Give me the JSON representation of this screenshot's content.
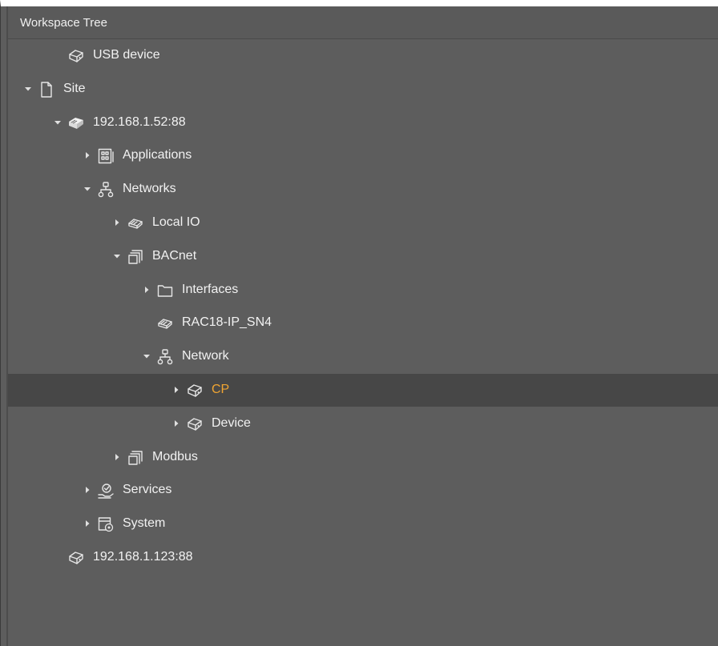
{
  "panel": {
    "title": "Workspace Tree"
  },
  "tree": [
    {
      "label": "USB device",
      "icon": "device-icon",
      "expand": "none",
      "selected": false
    },
    {
      "label": "Site",
      "icon": "page-icon",
      "expand": "expanded",
      "selected": false
    },
    {
      "label": "192.168.1.52:88",
      "icon": "connected-device-icon",
      "expand": "expanded",
      "selected": false
    },
    {
      "label": "Applications",
      "icon": "applications-icon",
      "expand": "collapsed",
      "selected": false
    },
    {
      "label": "Networks",
      "icon": "network-icon",
      "expand": "expanded",
      "selected": false
    },
    {
      "label": "Local IO",
      "icon": "io-module-icon",
      "expand": "collapsed",
      "selected": false
    },
    {
      "label": "BACnet",
      "icon": "protocol-icon",
      "expand": "expanded",
      "selected": false
    },
    {
      "label": "Interfaces",
      "icon": "folder-icon",
      "expand": "collapsed",
      "selected": false
    },
    {
      "label": "RAC18-IP_SN4",
      "icon": "io-module-icon",
      "expand": "none",
      "selected": false
    },
    {
      "label": "Network",
      "icon": "network-icon",
      "expand": "expanded",
      "selected": false
    },
    {
      "label": "CP",
      "icon": "device-icon",
      "expand": "collapsed",
      "selected": true
    },
    {
      "label": "Device",
      "icon": "device-icon",
      "expand": "collapsed",
      "selected": false
    },
    {
      "label": "Modbus",
      "icon": "protocol-icon",
      "expand": "collapsed",
      "selected": false
    },
    {
      "label": "Services",
      "icon": "services-icon",
      "expand": "collapsed",
      "selected": false
    },
    {
      "label": "System",
      "icon": "system-icon",
      "expand": "collapsed",
      "selected": false
    },
    {
      "label": "192.168.1.123:88",
      "icon": "device-icon",
      "expand": "none",
      "selected": false
    }
  ],
  "colors": {
    "background": "#5d5d5d",
    "selected_row": "#474747",
    "selected_text": "#f0a532",
    "text": "#f2f2f2"
  }
}
